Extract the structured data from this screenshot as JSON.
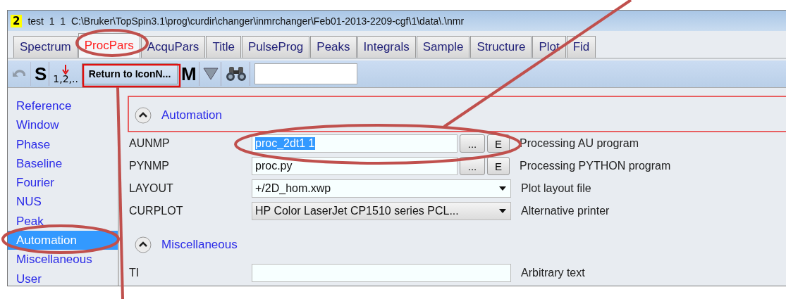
{
  "window": {
    "badge": "2",
    "title": "test  1  1  C:\\Bruker\\TopSpin3.1\\prog\\curdir\\changer\\inmrchanger\\Feb01-2013-2209-cgf\\1\\data\\.\\nmr"
  },
  "tabs": [
    {
      "label": "Spectrum",
      "selected": false
    },
    {
      "label": "ProcPars",
      "selected": true
    },
    {
      "label": "AcquPars",
      "selected": false
    },
    {
      "label": "Title",
      "selected": false
    },
    {
      "label": "PulseProg",
      "selected": false
    },
    {
      "label": "Peaks",
      "selected": false
    },
    {
      "label": "Integrals",
      "selected": false
    },
    {
      "label": "Sample",
      "selected": false
    },
    {
      "label": "Structure",
      "selected": false
    },
    {
      "label": "Plot",
      "selected": false
    },
    {
      "label": "Fid",
      "selected": false
    }
  ],
  "toolbar": [
    {
      "kind": "undo",
      "disabled": true
    },
    {
      "kind": "letter",
      "label": "S"
    },
    {
      "kind": "number",
      "label": "1,2,.."
    },
    {
      "kind": "button",
      "label": "Return to IconN..."
    },
    {
      "kind": "letter",
      "label": "M"
    },
    {
      "kind": "filter"
    },
    {
      "kind": "binoculars"
    },
    {
      "kind": "search"
    }
  ],
  "sidebar": {
    "items": [
      {
        "label": "Reference",
        "selected": false
      },
      {
        "label": "Window",
        "selected": false
      },
      {
        "label": "Phase",
        "selected": false
      },
      {
        "label": "Baseline",
        "selected": false
      },
      {
        "label": "Fourier",
        "selected": false
      },
      {
        "label": "NUS",
        "selected": false
      },
      {
        "label": "Peak",
        "selected": false
      },
      {
        "label": "Automation",
        "selected": true
      },
      {
        "label": "Miscellaneous",
        "selected": false
      },
      {
        "label": "User",
        "selected": false
      }
    ]
  },
  "sections": [
    {
      "title": "Automation",
      "expanded": true,
      "rows": [
        {
          "kind": "file",
          "name": "AUNMP",
          "value": "proc_2dt1 1",
          "highlighted": true,
          "buttons": [
            "...",
            "E"
          ],
          "description": "Processing AU program"
        },
        {
          "kind": "file",
          "name": "PYNMP",
          "value": "proc.py",
          "highlighted": false,
          "buttons": [
            "...",
            "E"
          ],
          "description": "Processing PYTHON program"
        },
        {
          "kind": "select",
          "name": "LAYOUT",
          "value": "+/2D_hom.xwp",
          "editable": true,
          "description": "Plot layout file"
        },
        {
          "kind": "select",
          "name": "CURPLOT",
          "value": "HP Color LaserJet CP1510 series PCL...",
          "editable": false,
          "description": "Alternative printer"
        }
      ]
    },
    {
      "title": "Miscellaneous",
      "expanded": true,
      "rows": [
        {
          "kind": "text",
          "name": "TI",
          "description": "Arbitrary text"
        }
      ]
    }
  ]
}
